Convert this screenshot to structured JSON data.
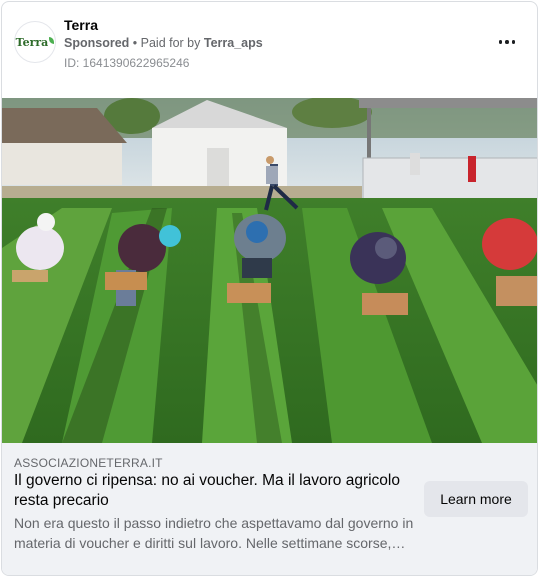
{
  "post": {
    "page_name": "Terra",
    "logo_text": "Terra",
    "sponsored_label": "Sponsored",
    "separator": " • ",
    "paid_prefix": "Paid for by ",
    "payer": "Terra_aps",
    "ad_id": "ID: 1641390622965246",
    "more_icon": "more-horizontal-icon"
  },
  "link_preview": {
    "domain": "ASSOCIAZIONETERRA.IT",
    "headline": "Il governo ci ripensa: no ai voucher. Ma il lavoro agricolo resta precario",
    "description": "Non era questo il passo indietro che aspettavamo dal governo in materia di voucher e diritti sul lavoro. Nelle settimane scorse, il…",
    "cta_label": "Learn more"
  },
  "colors": {
    "card_border": "#dadde1",
    "footer_bg": "#f0f2f5",
    "cta_bg": "#e4e6eb",
    "secondary_text": "#65676b"
  }
}
